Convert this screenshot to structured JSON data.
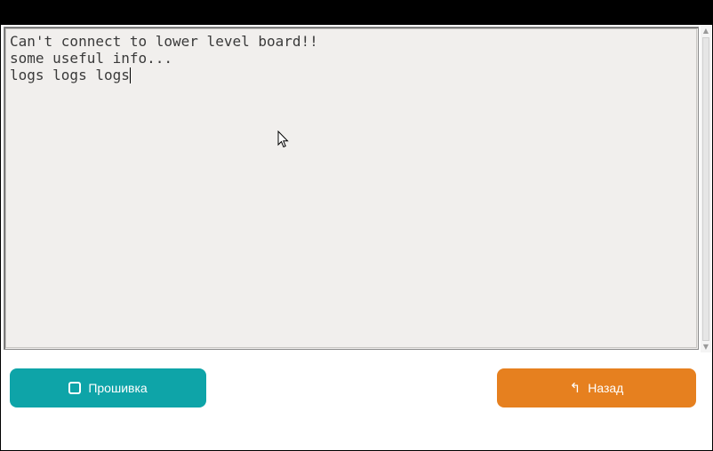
{
  "log": {
    "lines": [
      "Can't connect to lower level board!!",
      "some useful info...",
      "logs logs logs"
    ]
  },
  "buttons": {
    "firmware": {
      "label": "Прошивка",
      "icon": "square-icon",
      "color": "#0ea4a8"
    },
    "back": {
      "label": "Назад",
      "icon": "return-arrow-icon",
      "color": "#e6801f"
    }
  },
  "scrollbar": {
    "up_icon": "arrow-up-icon",
    "down_icon": "arrow-down-icon"
  }
}
